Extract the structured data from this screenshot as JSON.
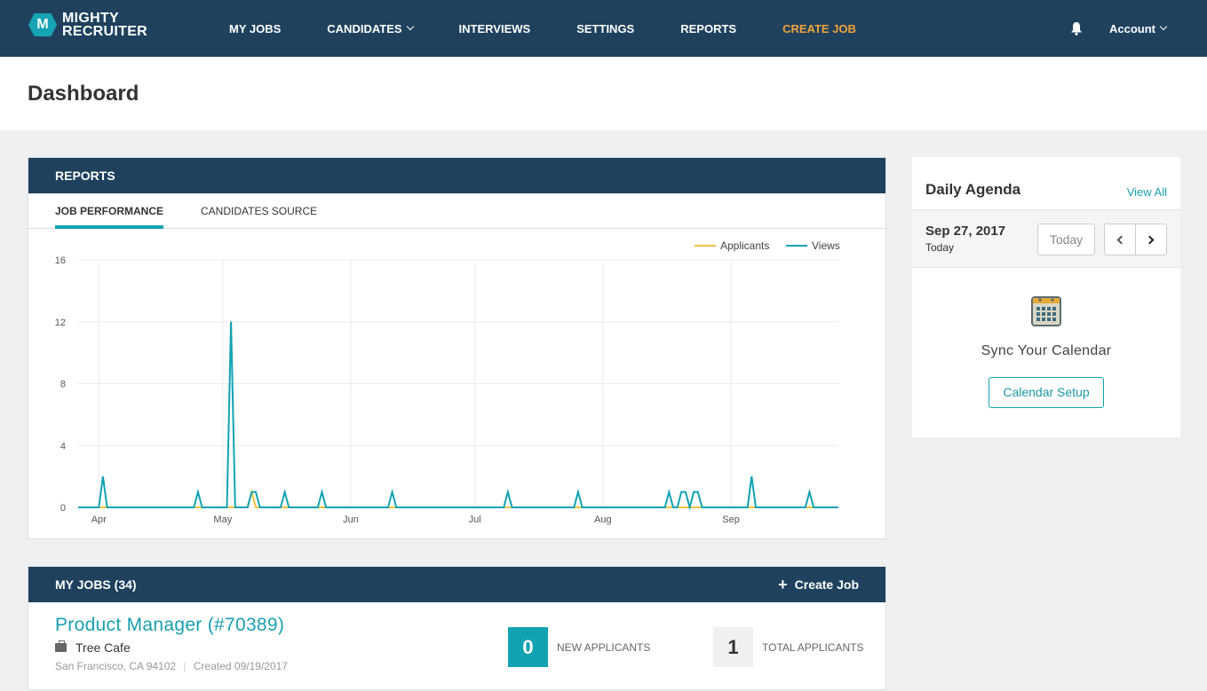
{
  "nav": {
    "logo_line1": "MIGHTY",
    "logo_line2": "RECRUITER",
    "logo_mark": "M",
    "items": [
      {
        "label": "MY JOBS",
        "dropdown": false,
        "accent": false
      },
      {
        "label": "CANDIDATES",
        "dropdown": true,
        "accent": false
      },
      {
        "label": "INTERVIEWS",
        "dropdown": false,
        "accent": false
      },
      {
        "label": "SETTINGS",
        "dropdown": false,
        "accent": false
      },
      {
        "label": "REPORTS",
        "dropdown": false,
        "accent": false
      },
      {
        "label": "CREATE JOB",
        "dropdown": false,
        "accent": true
      }
    ],
    "notification_icon": "bell-icon",
    "account_label": "Account"
  },
  "page": {
    "title": "Dashboard"
  },
  "reports": {
    "header": "REPORTS",
    "tabs": [
      {
        "label": "JOB PERFORMANCE",
        "active": true
      },
      {
        "label": "CANDIDATES SOURCE",
        "active": false
      }
    ]
  },
  "chart_data": {
    "type": "line",
    "title": "",
    "xlabel": "",
    "ylabel": "",
    "x_range": [
      "2017-03-27",
      "2017-09-27"
    ],
    "ylim": [
      0,
      16
    ],
    "y_ticks": [
      0,
      4,
      8,
      12,
      16
    ],
    "x_ticks": [
      {
        "date": "2017-04-01",
        "label": "Apr"
      },
      {
        "date": "2017-05-01",
        "label": "May"
      },
      {
        "date": "2017-06-01",
        "label": "Jun"
      },
      {
        "date": "2017-07-01",
        "label": "Jul"
      },
      {
        "date": "2017-08-01",
        "label": "Aug"
      },
      {
        "date": "2017-09-01",
        "label": "Sep"
      }
    ],
    "grid": true,
    "legend_position": "top-right",
    "series": [
      {
        "name": "Applicants",
        "color": "#f5c342",
        "points": [
          {
            "date": "2017-05-08",
            "value": 1
          }
        ]
      },
      {
        "name": "Views",
        "color": "#12a3b3",
        "points": [
          {
            "date": "2017-04-02",
            "value": 2
          },
          {
            "date": "2017-04-25",
            "value": 1
          },
          {
            "date": "2017-05-03",
            "value": 12
          },
          {
            "date": "2017-05-08",
            "value": 1
          },
          {
            "date": "2017-05-09",
            "value": 1
          },
          {
            "date": "2017-05-16",
            "value": 1
          },
          {
            "date": "2017-05-25",
            "value": 1
          },
          {
            "date": "2017-06-11",
            "value": 1
          },
          {
            "date": "2017-07-09",
            "value": 1
          },
          {
            "date": "2017-07-26",
            "value": 1
          },
          {
            "date": "2017-08-17",
            "value": 1
          },
          {
            "date": "2017-08-20",
            "value": 1
          },
          {
            "date": "2017-08-21",
            "value": 1
          },
          {
            "date": "2017-08-23",
            "value": 1
          },
          {
            "date": "2017-08-24",
            "value": 1
          },
          {
            "date": "2017-09-06",
            "value": 2
          },
          {
            "date": "2017-09-20",
            "value": 1
          }
        ]
      }
    ]
  },
  "agenda": {
    "title": "Daily Agenda",
    "view_all": "View All",
    "date": "Sep 27, 2017",
    "date_sub": "Today",
    "today_button": "Today",
    "sync_text": "Sync Your Calendar",
    "setup_button": "Calendar Setup"
  },
  "jobs": {
    "header": "MY JOBS (34)",
    "create_label": "Create Job",
    "items": [
      {
        "title": "Product Manager (#70389)",
        "company": "Tree Cafe",
        "location": "San Francisco, CA 94102",
        "created": "Created 09/19/2017",
        "new_applicants": "0",
        "new_applicants_label": "NEW APPLICANTS",
        "total_applicants": "1",
        "total_applicants_label": "TOTAL APPLICANTS"
      }
    ]
  },
  "colors": {
    "navy": "#1f415e",
    "teal": "#12a3b3",
    "orange": "#f0a33a",
    "yellow": "#f5c342"
  }
}
